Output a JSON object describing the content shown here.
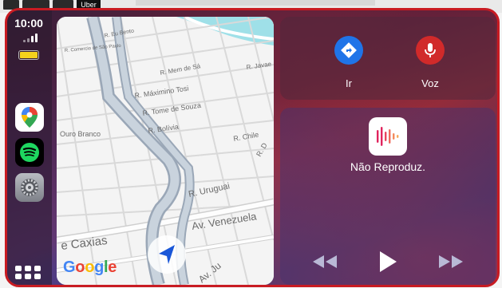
{
  "status": {
    "time": "10:00",
    "battery_color": "#f4d21c",
    "signal_bars": 4
  },
  "topstrip": {
    "app_label": "Uber"
  },
  "dock": {
    "apps": [
      {
        "name": "Google Maps",
        "icon": "google-maps-icon"
      },
      {
        "name": "Spotify",
        "icon": "spotify-icon"
      },
      {
        "name": "Settings",
        "icon": "settings-gear-icon"
      }
    ],
    "home_icon": "app-grid-icon"
  },
  "map": {
    "streets": [
      "R. Eu Bento",
      "R. Comercio de São Paulo",
      "R. Mem de Sá",
      "R. Javae",
      "R. Máximino Tosi",
      "R. Tome de Souza",
      "R. Bolívia",
      "R. Chile",
      "R. D",
      "Ouro Branco",
      "R. Uruguai",
      "Av. Venezuela",
      "e Caxias",
      "Av. Ju"
    ],
    "brand": "Google",
    "nav_icon": "navigation-arrow-icon"
  },
  "actions": {
    "go_label": "Ir",
    "voice_label": "Voz",
    "go_icon": "directions-icon",
    "voice_icon": "microphone-icon",
    "go_color": "#1f74e8",
    "voice_color": "#d12a2a"
  },
  "media": {
    "status": "Não Reproduz.",
    "app_icon": "podcast-waveform-icon",
    "controls": [
      "rewind-icon",
      "play-icon",
      "fast-forward-icon"
    ]
  }
}
